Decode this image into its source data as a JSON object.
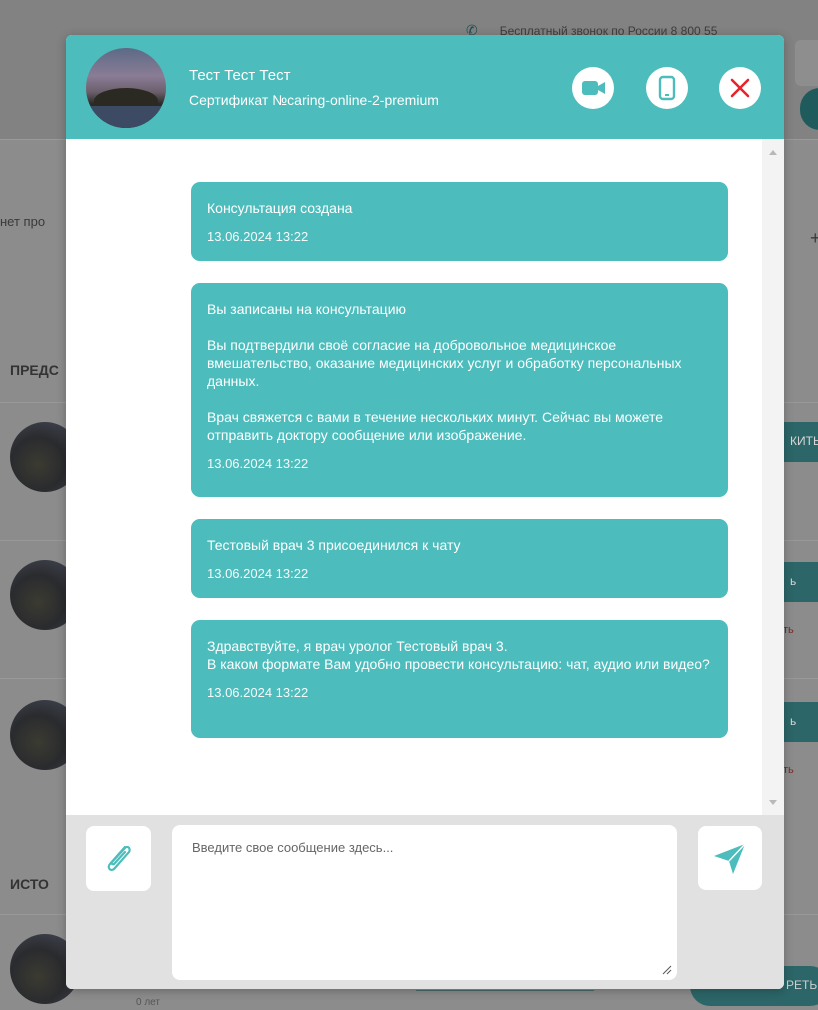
{
  "background": {
    "phone_line": "Бесплатный звонок по России   8 800 55",
    "partial_text": "нет про",
    "section_upcoming": "ПРЕДС",
    "section_history": "ИСТО",
    "pill_labels": [
      "КИТЬ",
      "ь",
      "ь",
      "РЕТЬ"
    ],
    "red_links": [
      "ть",
      "ть"
    ],
    "age": "0 лет",
    "plus_glyph": "+"
  },
  "chat": {
    "header": {
      "patient_name": "Тест Тест Тест",
      "certificate": "Сертификат №caring-online-2-premium",
      "buttons": {
        "video_icon": "video-camera-icon",
        "phone_icon": "mobile-phone-icon",
        "close_icon": "close-icon"
      }
    },
    "messages": [
      {
        "text": "Консультация создана",
        "time": "13.06.2024 13:22"
      },
      {
        "text": "Вы записаны на консультацию\n\nВы подтвердили своё согласие на добровольное медицинское вмешательство, оказание медицинских услуг и обработку персональных данных.\n\nВрач свяжется с вами в течение нескольких минут. Сейчас вы можете отправить доктору сообщение или изображение.",
        "time": "13.06.2024 13:22"
      },
      {
        "text": "Тестовый врач 3 присоединился к чату",
        "time": "13.06.2024 13:22"
      },
      {
        "text": "Здравствуйте, я врач уролог Тестовый врач 3.\nВ каком формате Вам удобно провести консультацию: чат, аудио или видео?",
        "time": "13.06.2024 13:22"
      }
    ],
    "composer": {
      "placeholder": "Введите свое сообщение здесь...",
      "value": "",
      "attach_icon": "paperclip-icon",
      "send_icon": "send-icon"
    }
  },
  "colors": {
    "accent": "#4cbcbc",
    "close_red": "#e8242a",
    "overlay_bg": "#8c8c8c"
  }
}
